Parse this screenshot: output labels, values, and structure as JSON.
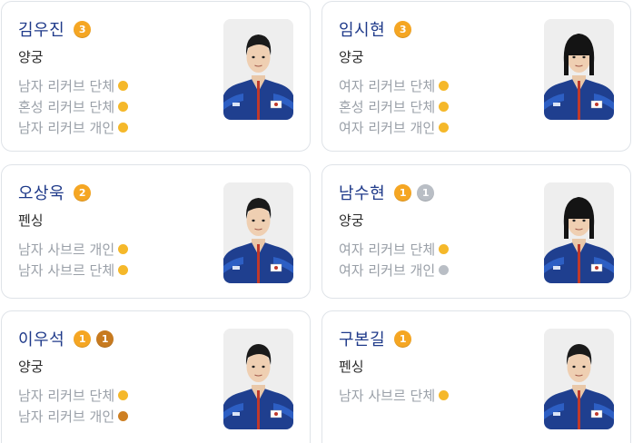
{
  "colors": {
    "name": "#1f3a8a",
    "gold": "#f5a623",
    "silver": "#b9bec5",
    "bronze": "#c77a1f",
    "event_text": "#9aa0a8"
  },
  "athletes": [
    {
      "name": "김우진",
      "medals": [
        {
          "type": "gold",
          "count": "3"
        }
      ],
      "sport": "양궁",
      "events": [
        {
          "label": "남자 리커브 단체",
          "medal": "gold"
        },
        {
          "label": "혼성 리커브 단체",
          "medal": "gold"
        },
        {
          "label": "남자 리커브 개인",
          "medal": "gold"
        }
      ],
      "photo_icon": "athlete-photo-male"
    },
    {
      "name": "임시현",
      "medals": [
        {
          "type": "gold",
          "count": "3"
        }
      ],
      "sport": "양궁",
      "events": [
        {
          "label": "여자 리커브 단체",
          "medal": "gold"
        },
        {
          "label": "혼성 리커브 단체",
          "medal": "gold"
        },
        {
          "label": "여자 리커브 개인",
          "medal": "gold"
        }
      ],
      "photo_icon": "athlete-photo-female"
    },
    {
      "name": "오상욱",
      "medals": [
        {
          "type": "gold",
          "count": "2"
        }
      ],
      "sport": "펜싱",
      "events": [
        {
          "label": "남자 사브르 개인",
          "medal": "gold"
        },
        {
          "label": "남자 사브르 단체",
          "medal": "gold"
        }
      ],
      "photo_icon": "athlete-photo-male"
    },
    {
      "name": "남수현",
      "medals": [
        {
          "type": "gold",
          "count": "1"
        },
        {
          "type": "silver",
          "count": "1"
        }
      ],
      "sport": "양궁",
      "events": [
        {
          "label": "여자 리커브 단체",
          "medal": "gold"
        },
        {
          "label": "여자 리커브 개인",
          "medal": "silver"
        }
      ],
      "photo_icon": "athlete-photo-female"
    },
    {
      "name": "이우석",
      "medals": [
        {
          "type": "gold",
          "count": "1"
        },
        {
          "type": "bronze",
          "count": "1"
        }
      ],
      "sport": "양궁",
      "events": [
        {
          "label": "남자 리커브 단체",
          "medal": "gold"
        },
        {
          "label": "남자 리커브 개인",
          "medal": "bronze"
        }
      ],
      "photo_icon": "athlete-photo-male"
    },
    {
      "name": "구본길",
      "medals": [
        {
          "type": "gold",
          "count": "1"
        }
      ],
      "sport": "펜싱",
      "events": [
        {
          "label": "남자 사브르 단체",
          "medal": "gold"
        }
      ],
      "photo_icon": "athlete-photo-male"
    }
  ]
}
